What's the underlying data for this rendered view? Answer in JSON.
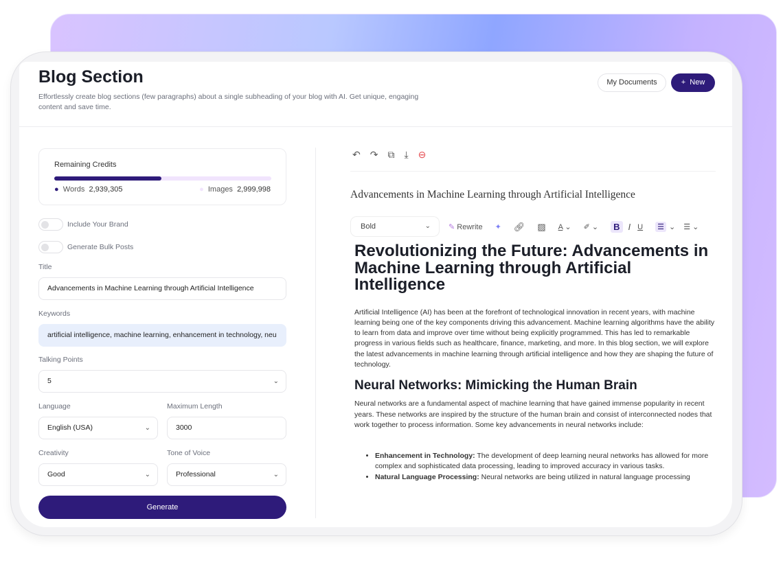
{
  "header": {
    "title": "Blog Section",
    "description": "Effortlessly create blog sections (few paragraphs) about a single subheading of your blog with AI. Get unique, engaging content and save time.",
    "my_documents": "My Documents",
    "new_label": "New",
    "new_icon": "plus-icon"
  },
  "credits": {
    "title": "Remaining Credits",
    "words_label": "Words",
    "words_value": "2,939,305",
    "images_label": "Images",
    "images_value": "2,999,998",
    "words_fraction": 0.495,
    "colors": {
      "words": "#2e1b7a",
      "images": "#f1e4fd"
    }
  },
  "toggles": [
    {
      "label": "Include Your Brand",
      "on": false
    },
    {
      "label": "Generate Bulk Posts",
      "on": false
    }
  ],
  "form": {
    "title_label": "Title",
    "title_value": "Advancements in Machine Learning through Artificial Intelligence",
    "keywords_label": "Keywords",
    "keywords_value": "artificial intelligence, machine learning, enhancement in technology, neu",
    "talking_points_label": "Talking Points",
    "talking_points_value": "5",
    "language_label": "Language",
    "language_value": "English (USA)",
    "max_length_label": "Maximum Length",
    "max_length_value": "3000",
    "creativity_label": "Creativity",
    "creativity_value": "Good",
    "tone_label": "Tone of Voice",
    "tone_value": "Professional",
    "generate": "Generate"
  },
  "editor": {
    "doc_title": "Advancements in Machine Learning through Artificial Intelligence",
    "format_value": "Bold",
    "rewrite": "Rewrite",
    "heading1": "Revolutionizing the Future: Advancements in Machine Learning through Artificial Intelligence",
    "para1": "Artificial Intelligence (AI) has been at the forefront of technological innovation in recent years, with machine learning being one of the key components driving this advancement. Machine learning algorithms have the ability to learn from data and improve over time without being explicitly programmed. This has led to remarkable progress in various fields such as healthcare, finance, marketing, and more. In this blog section, we will explore the latest advancements in machine learning through artificial intelligence and how they are shaping the future of technology.",
    "heading2": "Neural Networks: Mimicking the Human Brain",
    "para2": "Neural networks are a fundamental aspect of machine learning that have gained immense popularity in recent years. These networks are inspired by the structure of the human brain and consist of interconnected nodes that work together to process information. Some key advancements in neural networks include:",
    "bullets": [
      {
        "term": "Enhancement in Technology:",
        "text": " The development of deep learning neural networks has allowed for more complex and sophisticated data processing, leading to improved accuracy in various tasks."
      },
      {
        "term": "Natural Language Processing:",
        "text": " Neural networks are being utilized in natural language processing"
      }
    ],
    "accent": "#2e1b7a",
    "delete_color": "#e5484d"
  }
}
